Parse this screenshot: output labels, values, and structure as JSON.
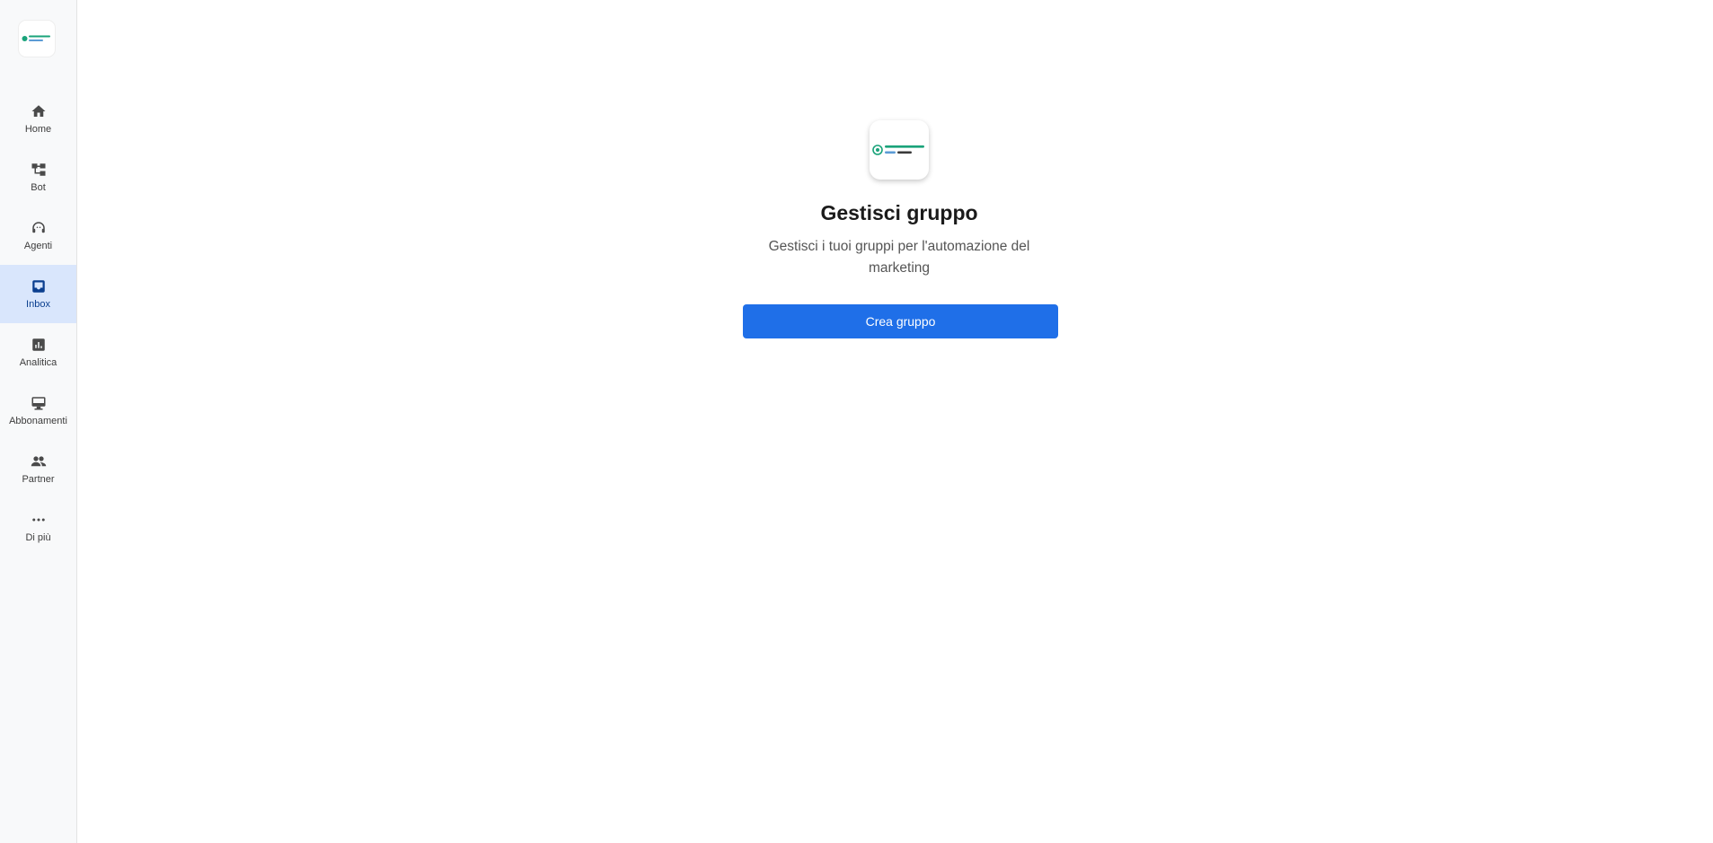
{
  "sidebar": {
    "brand_icon": "logo-icon",
    "items": [
      {
        "label": "Home",
        "icon": "home-icon",
        "active": false
      },
      {
        "label": "Bot",
        "icon": "flow-icon",
        "active": false
      },
      {
        "label": "Agenti",
        "icon": "headset-icon",
        "active": false
      },
      {
        "label": "Inbox",
        "icon": "inbox-icon",
        "active": true
      },
      {
        "label": "Analitica",
        "icon": "analytics-icon",
        "active": false
      },
      {
        "label": "Abbonamenti",
        "icon": "subscriptions-icon",
        "active": false
      },
      {
        "label": "Partner",
        "icon": "people-icon",
        "active": false
      },
      {
        "label": "Di più",
        "icon": "more-icon",
        "active": false
      }
    ]
  },
  "main": {
    "logo_icon": "logo-icon",
    "title": "Gestisci gruppo",
    "subtitle": "Gestisci i tuoi gruppi per l'automazione del marketing",
    "create_button_label": "Crea gruppo"
  },
  "colors": {
    "accent": "#1f6fe8",
    "active_nav_bg": "#d9e6fc",
    "brand_green": "#1aa37a"
  }
}
